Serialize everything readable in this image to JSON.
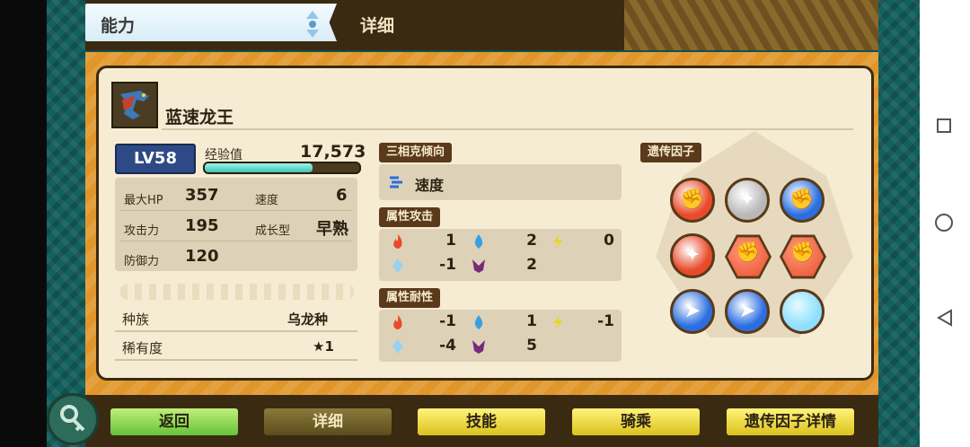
{
  "header": {
    "ability_tab": "能力",
    "detail_tab": "详细"
  },
  "monster": {
    "name": "蓝速龙王",
    "level": "LV58",
    "exp_label": "经验值",
    "exp_value": "17,573",
    "exp_progress": 0.7
  },
  "stats": {
    "hp_label": "最大HP",
    "hp_value": "357",
    "speed_label": "速度",
    "speed_value": "6",
    "attack_label": "攻击力",
    "attack_value": "195",
    "growth_label": "成长型",
    "growth_value": "早熟",
    "defense_label": "防御力",
    "defense_value": "120"
  },
  "info": {
    "race_label": "种族",
    "race_value": "乌龙种",
    "rarity_label": "稀有度",
    "rarity_value": "★1"
  },
  "affinity": {
    "title": "三相克倾向",
    "value": "速度"
  },
  "element_attack": {
    "title": "属性攻击",
    "fire": "1",
    "water": "2",
    "thunder": "0",
    "ice": "-1",
    "dragon": "2"
  },
  "element_resist": {
    "title": "属性耐性",
    "fire": "-1",
    "water": "1",
    "thunder": "-1",
    "ice": "-4",
    "dragon": "5"
  },
  "genes": {
    "title": "遗传因子",
    "items": [
      {
        "type": "power",
        "color": "#e84a2a"
      },
      {
        "type": "technique",
        "color": "#b8b8b8"
      },
      {
        "type": "power",
        "color": "#2a6ee0"
      },
      {
        "type": "technique",
        "color": "#e84a2a"
      },
      {
        "type": "power-hex",
        "color": "#e84a2a"
      },
      {
        "type": "power-hex",
        "color": "#e84a2a"
      },
      {
        "type": "speed",
        "color": "#2a6ee0"
      },
      {
        "type": "speed",
        "color": "#2a6ee0"
      },
      {
        "type": "empty",
        "color": "#8ee0ff"
      }
    ]
  },
  "buttons": {
    "back": "返回",
    "detail": "详细",
    "skills": "技能",
    "ride": "骑乘",
    "gene_detail": "遗传因子详情"
  },
  "colors": {
    "frame": "#e0962a",
    "panel": "#f6ecd4",
    "border": "#3c2a10",
    "accent_teal": "#3fc4b5",
    "level_badge": "#2e4a86"
  }
}
